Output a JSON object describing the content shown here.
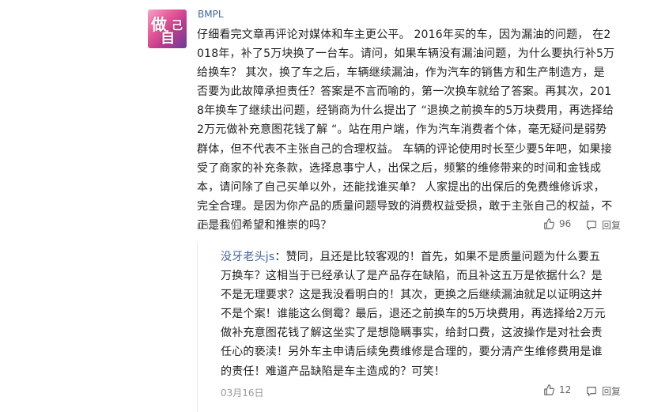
{
  "comment": {
    "username": "BMPL",
    "avatar_text": "做自己",
    "text": "仔细看完文章再评论对媒体和车主更公平。 2016年买的车，因为漏油的问题， 在2018年，补了5万块换了一台车。请问，如果车辆没有漏油问题，为什么要执行补5万给换车？ 其次，换了车之后，车辆继续漏油，作为汽车的销售方和生产制造方，是否要为此故障承担责任？答案是不言而喻的，第一次换车就给了答案。再其次，2018年换车了继续出问题，经销商为什么提出了 “退换之前换车的5万块费用，再选择给2万元做补充意图花钱了解 “。站在用户端，作为汽车消费者个体，毫无疑问是弱势群体，但不代表不主张自己的合理权益。 车辆的评论使用时长至少要5年吧，如果接受了商家的补充条款，选择息事宁人，出保之后，频繁的维修带来的时间和金钱成本，请问除了自己买单以外，还能找谁买单？ 人家提出的出保后的免费维修诉求，完全合理。是因为你产品的质量问题导致的消费权益受损，敢于主张自己的权益，不正是我们希望和推崇的吗？",
    "date": "03月16日",
    "likes": "96",
    "reply_label": "回复"
  },
  "reply": {
    "author": "没牙老头js",
    "separator": "：",
    "text": "赞同，且还是比较客观的！首先，如果不是质量问题为什么要五万换车？这相当于已经承认了是产品存在缺陷，而且补这五万是依据什么？是不是无理要求？这是我没看明白的！其次，更换之后继续漏油就足以证明这并不是个案！谁能这么倒霉？最后，退还之前换车的5万块费用，再选择给2万元做补充意图花钱了解这坐实了是想隐瞒事实，给封口费，这波操作是对社会责任心的亵渎！另外车主申请后续免费维修是合理的，要分清产生维修费用是谁的责任！难道产品缺陷是车主造成的？可笑！",
    "date": "03月16日",
    "likes": "12",
    "reply_label": "回复"
  },
  "colors": {
    "username": "#406599",
    "date": "#999999",
    "text": "#222222"
  },
  "icons": [
    "thumbs-up-icon",
    "reply-icon"
  ]
}
